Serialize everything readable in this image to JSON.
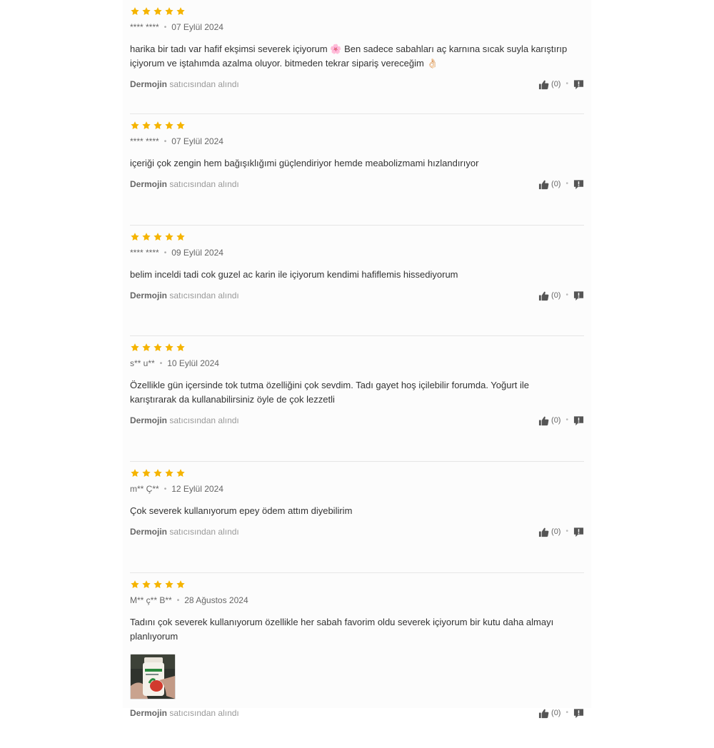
{
  "reviews": [
    {
      "rating": 5,
      "author": "**** ****",
      "date": "07 Eylül 2024",
      "text": "harika bir tadı var hafif ekşimsi severek içiyorum 🌸 Ben sadece sabahları aç karnına sıcak suyla karıştırıp içiyorum ve iştahımda azalma oluyor. bitmeden tekrar sipariş vereceğim 👌🏻",
      "seller": "Dermojin",
      "seller_suffix": "satıcısından alındı",
      "likes": "(0)"
    },
    {
      "rating": 5,
      "author": "**** ****",
      "date": "07 Eylül 2024",
      "text": "içeriği çok zengin hem bağışıklığımi güçlendiriyor hemde meabolizmami hızlandırıyor",
      "seller": "Dermojin",
      "seller_suffix": "satıcısından alındı",
      "likes": "(0)"
    },
    {
      "rating": 5,
      "author": "**** ****",
      "date": "09 Eylül 2024",
      "text": "belim inceldi tadi cok guzel ac karin ile içiyorum kendimi hafiflemis hissediyorum",
      "seller": "Dermojin",
      "seller_suffix": "satıcısından alındı",
      "likes": "(0)"
    },
    {
      "rating": 5,
      "author": "s** u**",
      "date": "10 Eylül 2024",
      "text": "Özellikle gün içersinde tok tutma özelliğini çok sevdim. Tadı gayet hoş içilebilir forumda. Yoğurt ile karıştırarak da kullanabilirsiniz öyle de çok lezzetli",
      "seller": "Dermojin",
      "seller_suffix": "satıcısından alındı",
      "likes": "(0)"
    },
    {
      "rating": 5,
      "author": "m** Ç**",
      "date": "12 Eylül 2024",
      "text": "Çok severek kullanıyorum epey ödem attım diyebilirim",
      "seller": "Dermojin",
      "seller_suffix": "satıcısından alındı",
      "likes": "(0)"
    },
    {
      "rating": 5,
      "author": "M** ç** B**",
      "date": "28 Ağustos 2024",
      "text": "Tadını çok severek kullanıyorum özellikle her sabah favorim oldu severek içiyorum bir kutu daha almayı planlıyorum",
      "seller": "Dermojin",
      "seller_suffix": "satıcısından alındı",
      "likes": "(0)",
      "has_photo": true
    }
  ],
  "colors": {
    "star": "#f5b400",
    "icon": "#555555"
  }
}
